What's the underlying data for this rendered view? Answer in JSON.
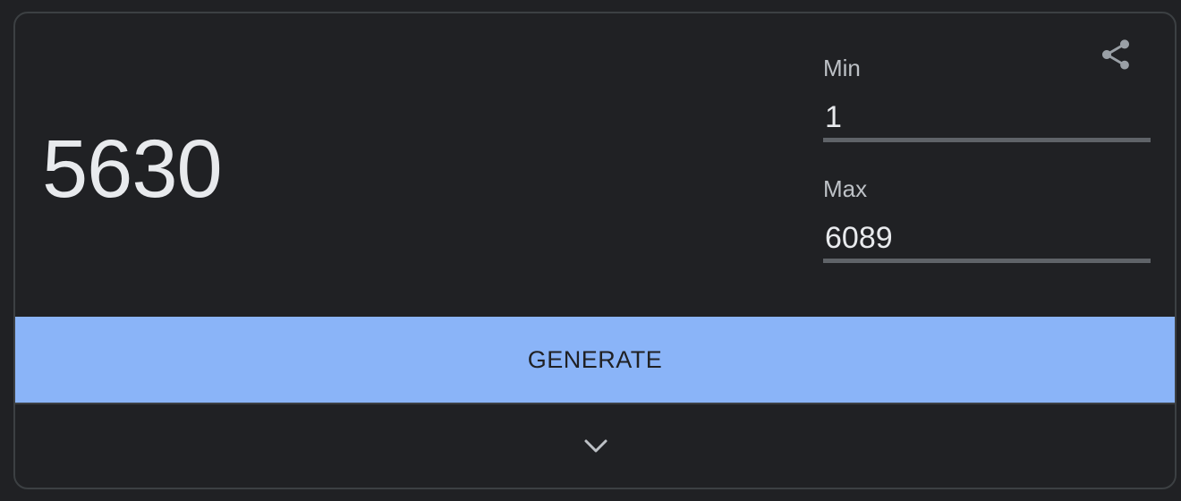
{
  "generator": {
    "result": "5630",
    "min": {
      "label": "Min",
      "value": "1"
    },
    "max": {
      "label": "Max",
      "value": "6089"
    },
    "generate_label": "GENERATE",
    "share_icon": "share-icon",
    "expand_icon": "chevron-down-icon"
  },
  "colors": {
    "background": "#202124",
    "accent": "#8ab4f8",
    "text": "#e8eaed",
    "muted_text": "#bdc1c6",
    "underline": "#5f6368",
    "border": "#3c4043"
  }
}
